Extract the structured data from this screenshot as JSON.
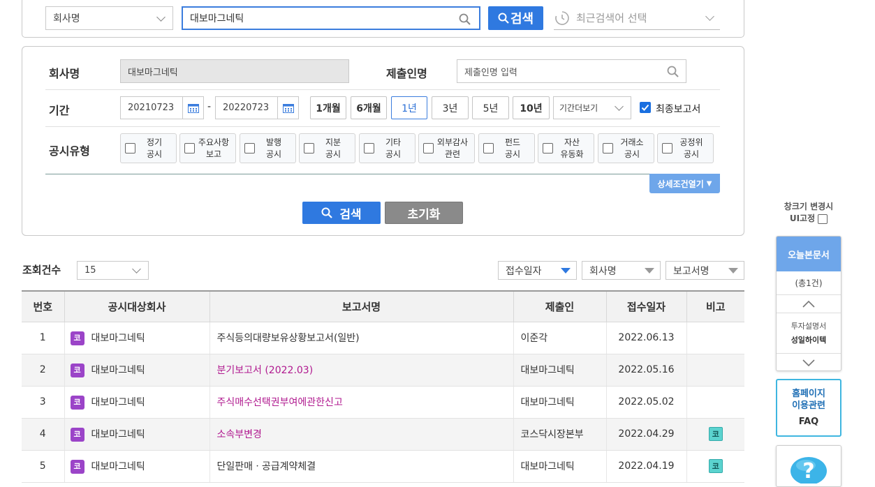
{
  "search": {
    "category_select": "회사명",
    "query": "대보마그네틱",
    "search_button": "검색",
    "recent_placeholder": "최근검색어 선택"
  },
  "detail": {
    "company_label": "회사명",
    "company_value": "대보마그네틱",
    "submitter_label": "제출인명",
    "submitter_placeholder": "제출인명 입력",
    "period_label": "기간",
    "date_from": "20210723",
    "date_sep": "-",
    "date_to": "20220723",
    "periods": [
      "1개월",
      "6개월",
      "1년",
      "3년",
      "5년",
      "10년"
    ],
    "period_more": "기간더보기",
    "final_report_label": "최종보고서",
    "type_label": "공시유형",
    "types": [
      {
        "l1": "정기",
        "l2": "공시"
      },
      {
        "l1": "주요사항",
        "l2": "보고"
      },
      {
        "l1": "발행",
        "l2": "공시"
      },
      {
        "l1": "지분",
        "l2": "공시"
      },
      {
        "l1": "기타",
        "l2": "공시"
      },
      {
        "l1": "외부감사",
        "l2": "관련"
      },
      {
        "l1": "펀드",
        "l2": "공시"
      },
      {
        "l1": "자산",
        "l2": "유동화"
      },
      {
        "l1": "거래소",
        "l2": "공시"
      },
      {
        "l1": "공정위",
        "l2": "공시"
      }
    ],
    "advanced_button": "상세조건열기",
    "search_button": "검색",
    "reset_button": "초기화"
  },
  "results": {
    "count_label": "조회건수",
    "count_value": "15",
    "sort_options": [
      "접수일자",
      "회사명",
      "보고서명"
    ],
    "headers": [
      "번호",
      "공시대상회사",
      "보고서명",
      "제출인",
      "접수일자",
      "비고"
    ],
    "rows": [
      {
        "no": "1",
        "badge": "코",
        "company": "대보마그네틱",
        "report": "주식등의대량보유상황보고서(일반)",
        "submitter": "이준각",
        "date": "2022.06.13",
        "note": ""
      },
      {
        "no": "2",
        "badge": "코",
        "company": "대보마그네틱",
        "report": "분기보고서 (2022.03)",
        "submitter": "대보마그네틱",
        "date": "2022.05.16",
        "note": ""
      },
      {
        "no": "3",
        "badge": "코",
        "company": "대보마그네틱",
        "report": "주식매수선택권부여에관한신고",
        "submitter": "대보마그네틱",
        "date": "2022.05.02",
        "note": ""
      },
      {
        "no": "4",
        "badge": "코",
        "company": "대보마그네틱",
        "report": "소속부변경",
        "submitter": "코스닥시장본부",
        "date": "2022.04.29",
        "note": "코"
      },
      {
        "no": "5",
        "badge": "코",
        "company": "대보마그네틱",
        "report": "단일판매ㆍ공급계약체결",
        "submitter": "대보마그네틱",
        "date": "2022.04.19",
        "note": "코"
      }
    ]
  },
  "sidebar": {
    "ui_fix_label_1": "창크기 변경시",
    "ui_fix_label_2": "UI고정",
    "today_title": "오늘본문서",
    "today_count": "(총1건)",
    "doc_type": "투자설명서",
    "doc_company": "성일하이텍",
    "faq_line1": "홈페이지",
    "faq_line2": "이용관련",
    "faq_line3": "FAQ"
  },
  "colors": {
    "accent": "#2f79e0",
    "link": "#b0198f",
    "badge_ko": "#9b44c8",
    "note_badge": "#5bd3cf",
    "sidebar_header": "#6ea6ea"
  }
}
